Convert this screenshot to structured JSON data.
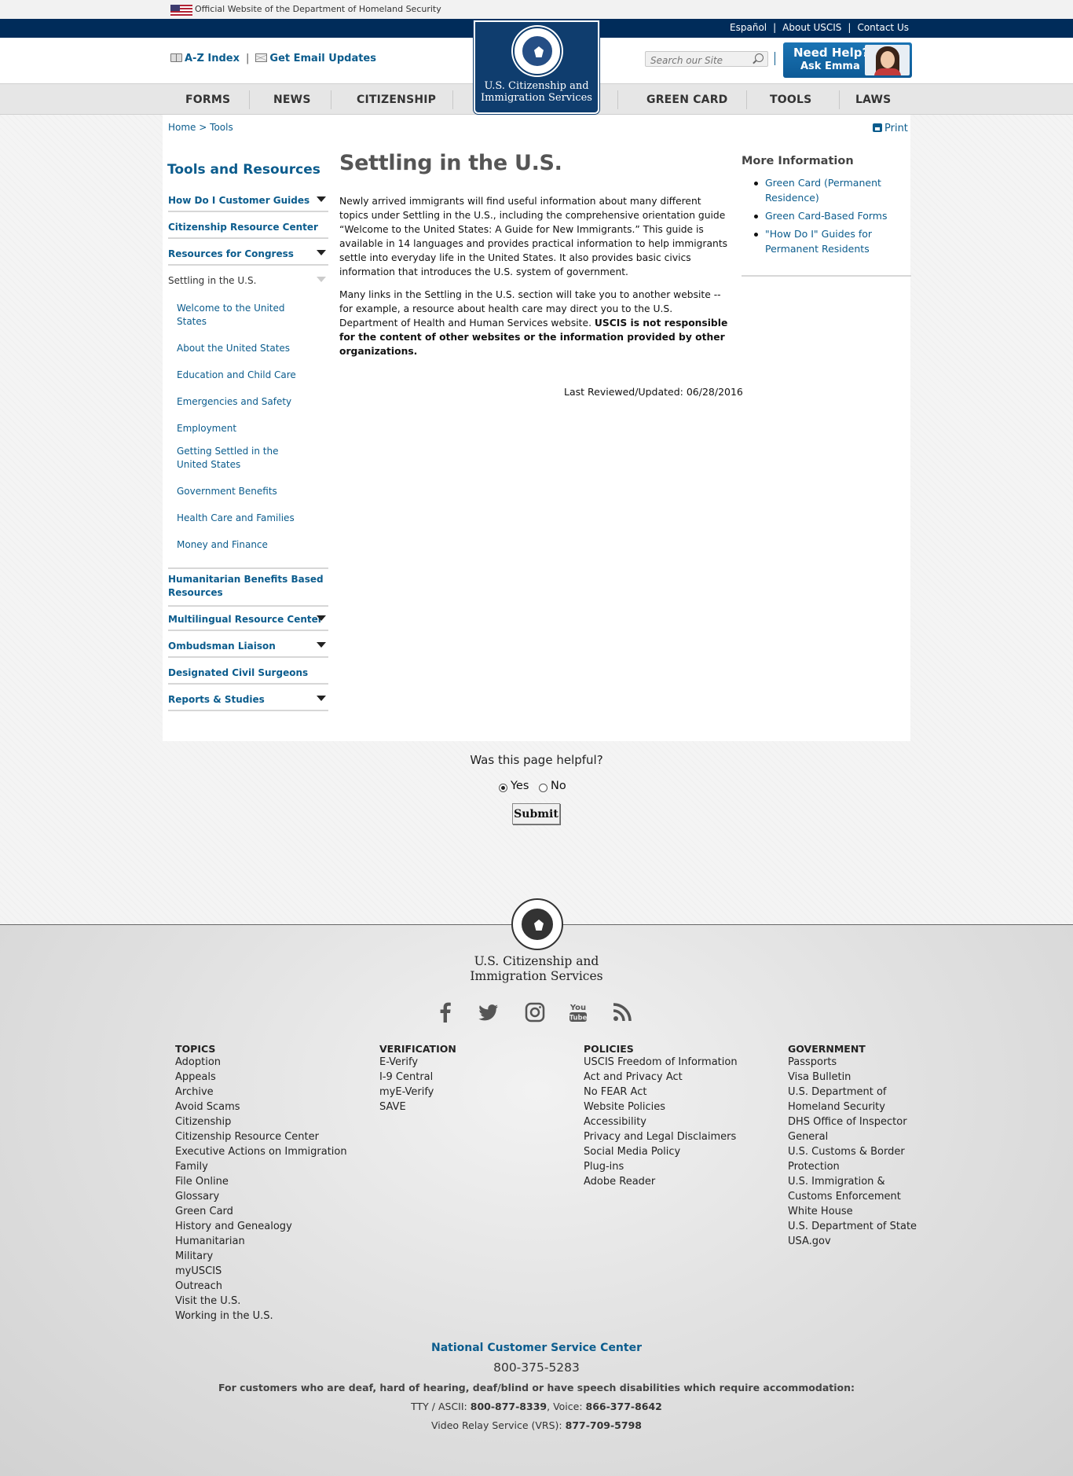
{
  "official_banner": "Official Website of the Department of Homeland Security",
  "util_links": [
    "Español",
    "About USCIS",
    "Contact Us"
  ],
  "header": {
    "az_index": "A-Z Index",
    "email_updates": "Get Email Updates",
    "search_placeholder": "Search our Site",
    "help_title": "Need Help?",
    "help_sub": "Ask Emma"
  },
  "logo": {
    "line1": "U.S. Citizenship and",
    "line2": "Immigration Services"
  },
  "nav": [
    "FORMS",
    "NEWS",
    "CITIZENSHIP",
    "GREEN CARD",
    "TOOLS",
    "LAWS"
  ],
  "breadcrumb": {
    "home": "Home",
    "sep": ">",
    "current": "Tools"
  },
  "print_label": "Print",
  "sidebar": {
    "title": "Tools and Resources",
    "items": [
      "How Do I Customer Guides",
      "Citizenship Resource Center",
      "Resources for Congress",
      "Settling in the U.S.",
      "Humanitarian Benefits Based Resources",
      "Multilingual Resource Center",
      "Ombudsman Liaison",
      "Designated Civil Surgeons",
      "Reports & Studies"
    ],
    "subitems": [
      "Welcome to the United States",
      "About the United States",
      "Education and Child Care",
      "Emergencies and Safety",
      "Employment",
      "Getting Settled in the United States",
      "Government Benefits",
      "Health Care and Families",
      "Money and Finance"
    ]
  },
  "main": {
    "title": "Settling in the U.S.",
    "p1": "Newly arrived immigrants will find useful information about many different topics under Settling in the U.S., including the comprehensive orientation guide “Welcome to the United States: A Guide for New Immigrants.” This guide is available in 14 languages and provides practical information to help immigrants settle into everyday life in the United States. It also provides basic civics information that introduces the U.S. system of government.",
    "p2": "Many links in the Settling in the U.S. section will take you to another website -- for example, a resource about health care may direct you to the U.S. Department of Health and Human Services website.",
    "p2_bold": "USCIS is not responsible for the content of other websites or the information provided by other organizations.",
    "reviewed": "Last Reviewed/Updated: 06/28/2016"
  },
  "more_info": {
    "title": "More Information",
    "links": [
      "Green Card (Permanent Residence)",
      "Green Card-Based Forms",
      "\"How Do I\" Guides for Permanent Residents"
    ]
  },
  "feedback": {
    "question": "Was this page helpful?",
    "yes": "Yes",
    "no": "No",
    "submit": "Submit",
    "selected": "Yes"
  },
  "footer": {
    "name1": "U.S. Citizenship and",
    "name2": "Immigration Services",
    "social_icons": [
      "facebook-icon",
      "twitter-icon",
      "instagram-icon",
      "youtube-icon",
      "rss-icon"
    ],
    "columns": [
      {
        "title": "TOPICS",
        "links": [
          "Adoption",
          "Appeals",
          "Archive",
          "Avoid Scams",
          "Citizenship",
          "Citizenship Resource Center",
          "Executive Actions on Immigration",
          "Family",
          "File Online",
          "Glossary",
          "Green Card",
          "History and Genealogy",
          "Humanitarian",
          "Military",
          "myUSCIS",
          "Outreach",
          "Visit the U.S.",
          "Working in the U.S."
        ]
      },
      {
        "title": "VERIFICATION",
        "links": [
          "E-Verify",
          "I-9 Central",
          "myE-Verify",
          "SAVE"
        ]
      },
      {
        "title": "POLICIES",
        "links": [
          "USCIS Freedom of Information",
          "Act and Privacy Act",
          "No FEAR Act",
          "Website Policies",
          "Accessibility",
          "Privacy and Legal Disclaimers",
          "Social Media Policy",
          "Plug-ins",
          "Adobe Reader"
        ]
      },
      {
        "title": "GOVERNMENT",
        "links": [
          "Passports",
          "Visa Bulletin",
          "U.S. Department of",
          "Homeland Security",
          "DHS Office of Inspector",
          "General",
          "U.S. Customs & Border",
          "Protection",
          "U.S. Immigration &",
          "Customs Enforcement",
          "White House",
          "U.S. Department of State",
          "USA.gov"
        ]
      }
    ],
    "ncsc_title": "National Customer Service Center",
    "ncsc_phone": "800-375-5283",
    "ncsc_desc": "For customers who are deaf, hard of hearing, deaf/blind or have speech disabilities which require accommodation:",
    "tty_label": "TTY / ASCII:",
    "tty_num": "800-877-8339",
    "voice_label": "Voice:",
    "voice_num": "866-377-8642",
    "vrs_label": "Video Relay Service (VRS):",
    "vrs_num": "877-709-5798"
  }
}
